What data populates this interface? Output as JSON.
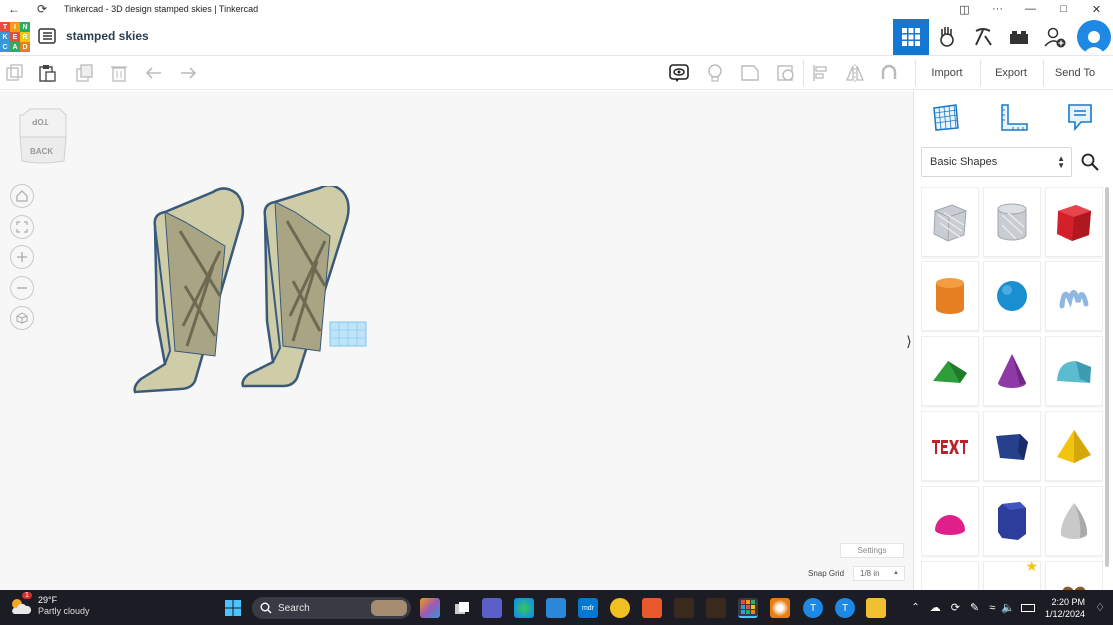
{
  "window": {
    "title": "Tinkercad - 3D design stamped skies | Tinkercad"
  },
  "logo": {
    "letters": [
      "T",
      "I",
      "N",
      "K",
      "E",
      "R",
      "C",
      "A",
      "D"
    ],
    "colors": [
      "#e74c3c",
      "#f39c12",
      "#27ae60",
      "#3498db",
      "#e74c3c",
      "#f1c40f",
      "#3498db",
      "#27ae60",
      "#e67e22"
    ]
  },
  "header": {
    "design_name": "stamped skies"
  },
  "toolbar": {
    "import_label": "Import",
    "export_label": "Export",
    "send_to_label": "Send To"
  },
  "canvas": {
    "viewcube_top": "TOP",
    "viewcube_back": "BACK",
    "settings_label": "Settings",
    "snap_grid_label": "Snap Grid",
    "snap_grid_value": "1/8 in"
  },
  "panel": {
    "category": "Basic Shapes",
    "shapes": [
      {
        "name": "box-hole",
        "color": "#c9cdd3"
      },
      {
        "name": "cylinder-hole",
        "color": "#c9cdd3"
      },
      {
        "name": "box",
        "color": "#d4202b"
      },
      {
        "name": "cylinder",
        "color": "#e67e22"
      },
      {
        "name": "sphere",
        "color": "#1a8fd0"
      },
      {
        "name": "scribble",
        "color": "#8fb8e0"
      },
      {
        "name": "roof",
        "color": "#2e9d3a"
      },
      {
        "name": "cone",
        "color": "#8e3aa6"
      },
      {
        "name": "round-roof",
        "color": "#5bbcd0"
      },
      {
        "name": "text",
        "color": "#c0202a"
      },
      {
        "name": "half-box",
        "color": "#27408b"
      },
      {
        "name": "pyramid",
        "color": "#f1c40f"
      },
      {
        "name": "half-sphere",
        "color": "#e0208a"
      },
      {
        "name": "polygon",
        "color": "#2c3e9a"
      },
      {
        "name": "paraboloid",
        "color": "#c9c9c9"
      }
    ]
  },
  "taskbar": {
    "weather_badge": "1",
    "temperature": "29°F",
    "condition": "Partly cloudy",
    "search_placeholder": "Search",
    "time": "2:20 PM",
    "date": "1/12/2024"
  },
  "colors": {
    "accent": "#1477d1",
    "model_fill": "#cfcca8",
    "model_stroke": "#3a5a7a"
  }
}
